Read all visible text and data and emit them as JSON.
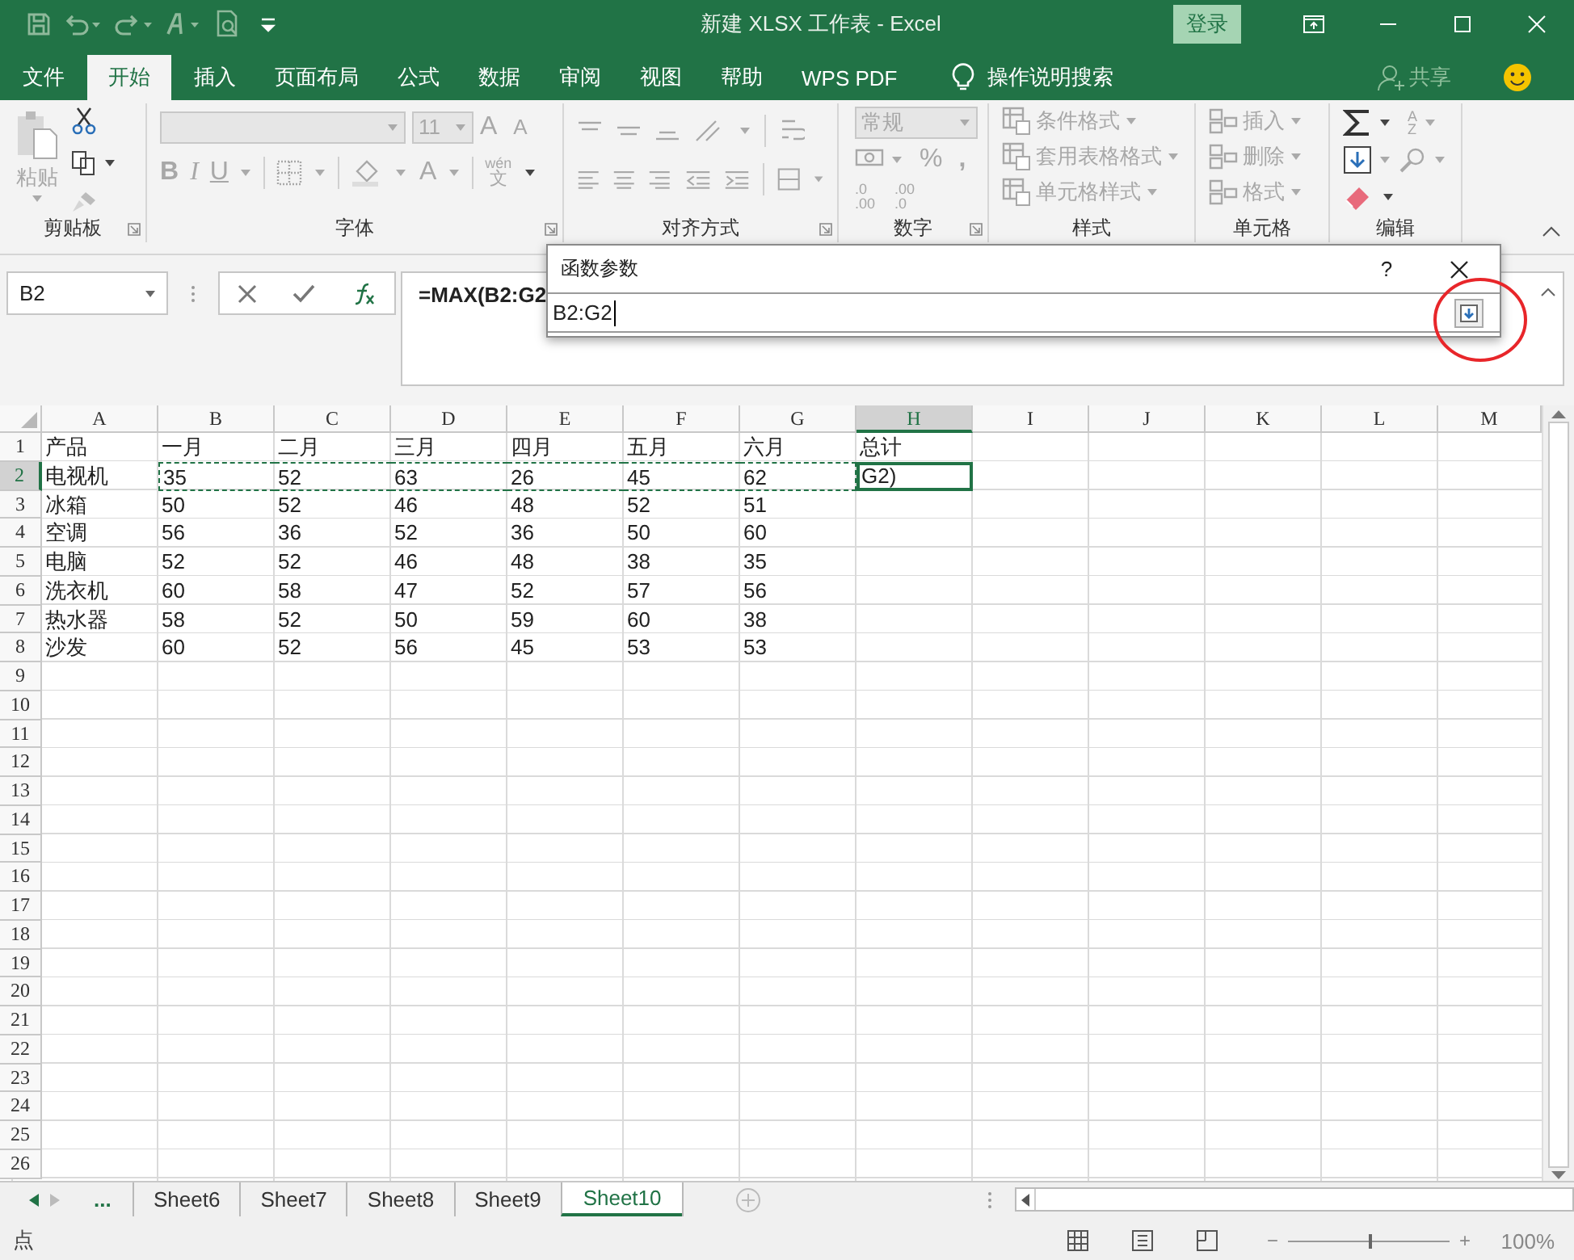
{
  "title_bar": {
    "title": "新建 XLSX 工作表  -  Excel",
    "login": "登录"
  },
  "ribbon_tabs": [
    {
      "label": "文件",
      "selected": false
    },
    {
      "label": "开始",
      "selected": true
    },
    {
      "label": "插入",
      "selected": false
    },
    {
      "label": "页面布局",
      "selected": false
    },
    {
      "label": "公式",
      "selected": false
    },
    {
      "label": "数据",
      "selected": false
    },
    {
      "label": "审阅",
      "selected": false
    },
    {
      "label": "视图",
      "selected": false
    },
    {
      "label": "帮助",
      "selected": false
    },
    {
      "label": "WPS PDF",
      "selected": false
    }
  ],
  "tell_me": "操作说明搜索",
  "share": "共享",
  "ribbon": {
    "clipboard": {
      "paste": "粘贴",
      "label": "剪贴板",
      "disabled": true
    },
    "font": {
      "size": "11",
      "grow": "A",
      "shrink": "A",
      "bold": "B",
      "italic": "I",
      "underline": "U",
      "font_color": "A",
      "phonetic_top": "wén",
      "phonetic_bottom": "文",
      "label": "字体",
      "disabled": true
    },
    "alignment": {
      "label": "对齐方式"
    },
    "number": {
      "format": "常规",
      "percent": "%",
      "comma": ",",
      "increase_decimal": {
        "top": ".0",
        "bottom": ".00"
      },
      "decrease_decimal": {
        "top": ".00",
        "bottom": ".0"
      },
      "label": "数字",
      "disabled": true
    },
    "styles": {
      "items": [
        "条件格式",
        "套用表格格式",
        "单元格样式"
      ],
      "label": "样式",
      "disabled": true
    },
    "cells": {
      "items": [
        "插入",
        "删除",
        "格式"
      ],
      "label": "单元格",
      "disabled": true
    },
    "editing": {
      "sort_top": "A",
      "sort_bottom": "Z",
      "label": "编辑"
    }
  },
  "formula_bar": {
    "name_box": "B2",
    "formula": "=MAX(B2:G2"
  },
  "dialog": {
    "title": "函数参数",
    "help": "?",
    "value": "B2:G2"
  },
  "sheet": {
    "columns": [
      {
        "label": "A",
        "selected": false
      },
      {
        "label": "B",
        "selected": false
      },
      {
        "label": "C",
        "selected": false
      },
      {
        "label": "D",
        "selected": false
      },
      {
        "label": "E",
        "selected": false
      },
      {
        "label": "F",
        "selected": false
      },
      {
        "label": "G",
        "selected": false
      },
      {
        "label": "H",
        "selected": true
      },
      {
        "label": "I",
        "selected": false
      },
      {
        "label": "J",
        "selected": false
      },
      {
        "label": "K",
        "selected": false
      },
      {
        "label": "L",
        "selected": false
      },
      {
        "label": "M",
        "selected": false
      }
    ],
    "rows": [
      {
        "label": "1",
        "selected": false,
        "copy_range": false,
        "cells": [
          "产品",
          "一月",
          "二月",
          "三月",
          "四月",
          "五月",
          "六月",
          "总计"
        ]
      },
      {
        "label": "2",
        "selected": true,
        "copy_range": true,
        "cells": [
          "电视机",
          "35",
          "52",
          "63",
          "26",
          "45",
          "62",
          "G2)"
        ]
      },
      {
        "label": "3",
        "selected": false,
        "copy_range": false,
        "cells": [
          "冰箱",
          "50",
          "52",
          "46",
          "48",
          "52",
          "51"
        ]
      },
      {
        "label": "4",
        "selected": false,
        "copy_range": false,
        "cells": [
          "空调",
          "56",
          "36",
          "52",
          "36",
          "50",
          "60"
        ]
      },
      {
        "label": "5",
        "selected": false,
        "copy_range": false,
        "cells": [
          "电脑",
          "52",
          "52",
          "46",
          "48",
          "38",
          "35"
        ]
      },
      {
        "label": "6",
        "selected": false,
        "copy_range": false,
        "cells": [
          "洗衣机",
          "60",
          "58",
          "47",
          "52",
          "57",
          "56"
        ]
      },
      {
        "label": "7",
        "selected": false,
        "copy_range": false,
        "cells": [
          "热水器",
          "58",
          "52",
          "50",
          "59",
          "60",
          "38"
        ]
      },
      {
        "label": "8",
        "selected": false,
        "copy_range": false,
        "cells": [
          "沙发",
          "60",
          "52",
          "56",
          "45",
          "53",
          "53"
        ]
      },
      {
        "label": "9",
        "selected": false,
        "copy_range": false
      },
      {
        "label": "10",
        "selected": false,
        "copy_range": false
      },
      {
        "label": "11",
        "selected": false,
        "copy_range": false
      },
      {
        "label": "12",
        "selected": false,
        "copy_range": false
      },
      {
        "label": "13",
        "selected": false,
        "copy_range": false
      },
      {
        "label": "14",
        "selected": false,
        "copy_range": false
      },
      {
        "label": "15",
        "selected": false,
        "copy_range": false
      },
      {
        "label": "16",
        "selected": false,
        "copy_range": false
      },
      {
        "label": "17",
        "selected": false,
        "copy_range": false
      },
      {
        "label": "18",
        "selected": false,
        "copy_range": false
      },
      {
        "label": "19",
        "selected": false,
        "copy_range": false
      },
      {
        "label": "20",
        "selected": false,
        "copy_range": false
      },
      {
        "label": "21",
        "selected": false,
        "copy_range": false
      },
      {
        "label": "22",
        "selected": false,
        "copy_range": false
      },
      {
        "label": "23",
        "selected": false,
        "copy_range": false
      },
      {
        "label": "24",
        "selected": false,
        "copy_range": false
      },
      {
        "label": "25",
        "selected": false,
        "copy_range": false
      },
      {
        "label": "26",
        "selected": false,
        "copy_range": false
      }
    ]
  },
  "sheet_tabs": {
    "more": "...",
    "tabs": [
      {
        "label": "Sheet6",
        "selected": false
      },
      {
        "label": "Sheet7",
        "selected": false
      },
      {
        "label": "Sheet8",
        "selected": false
      },
      {
        "label": "Sheet9",
        "selected": false
      },
      {
        "label": "Sheet10",
        "selected": true
      }
    ]
  },
  "status_bar": {
    "mode": "点",
    "zoom_minus": "−",
    "zoom_plus": "+",
    "zoom": {
      "level": 0.5,
      "reading": "100%"
    }
  }
}
